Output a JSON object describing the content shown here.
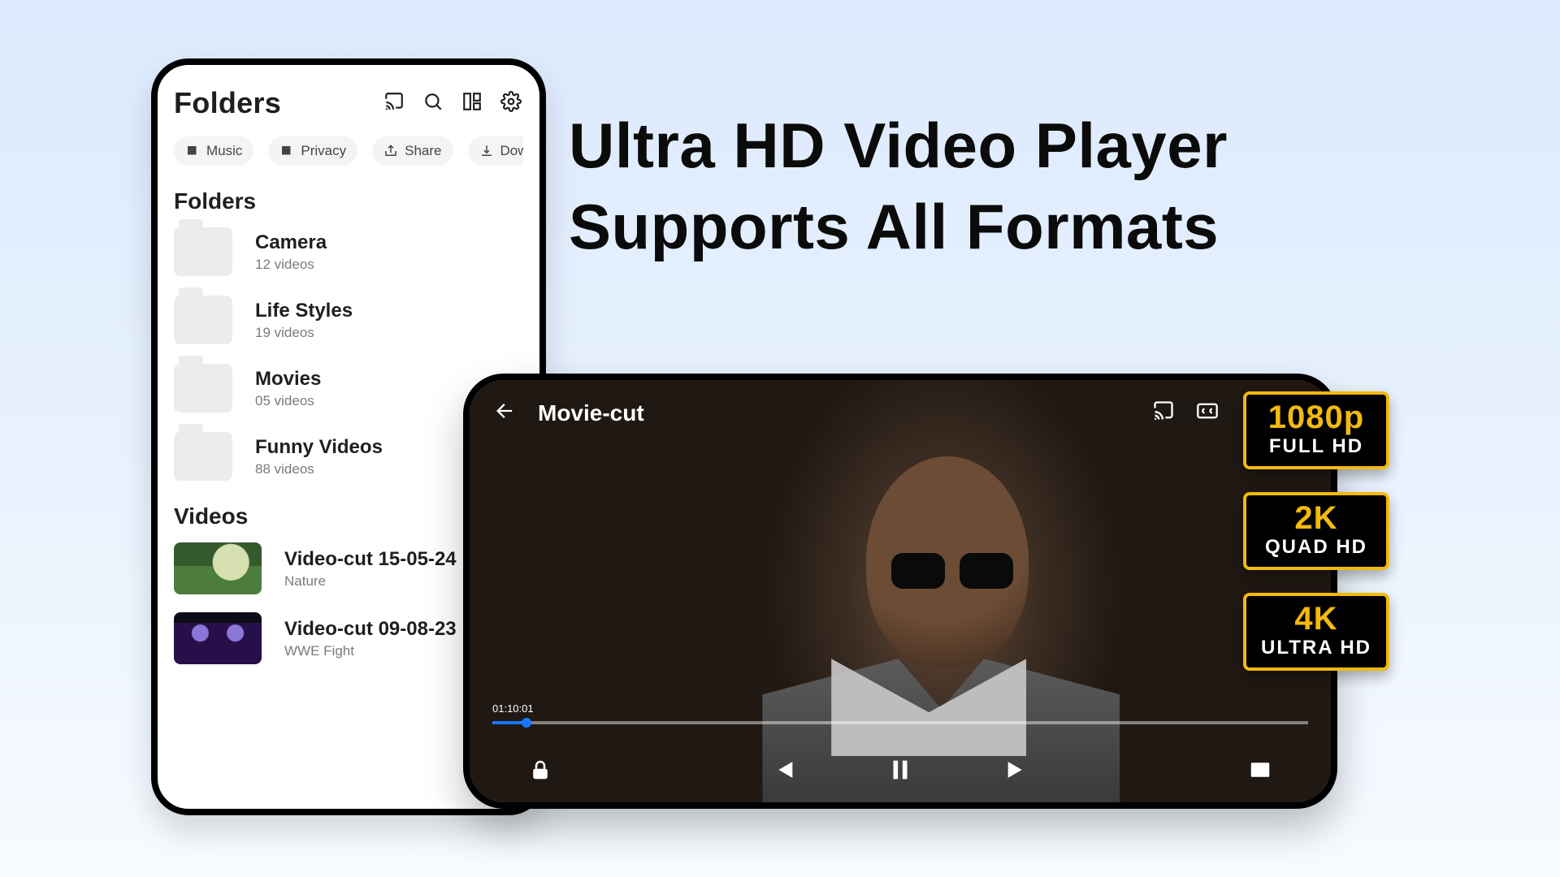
{
  "headline": {
    "line1": "Ultra HD Video Player",
    "line2": "Supports All Formats"
  },
  "phone": {
    "title": "Folders",
    "tabs": [
      {
        "label": "Music"
      },
      {
        "label": "Privacy"
      },
      {
        "label": "Share"
      },
      {
        "label": "Downloader"
      }
    ],
    "folders_section": "Folders",
    "folders": [
      {
        "name": "Camera",
        "sub": "12 videos"
      },
      {
        "name": "Life Styles",
        "sub": "19 videos"
      },
      {
        "name": "Movies",
        "sub": "05 videos"
      },
      {
        "name": "Funny Videos",
        "sub": "88 videos"
      }
    ],
    "videos_section": "Videos",
    "videos": [
      {
        "name": "Video-cut 15-05-24",
        "sub": "Nature",
        "thumb": "nature"
      },
      {
        "name": "Video-cut 09-08-23",
        "sub": "WWE Fight",
        "thumb": "wwe"
      }
    ]
  },
  "player": {
    "title": "Movie-cut",
    "time": "01:10:01"
  },
  "badges": [
    {
      "top": "1080p",
      "bottom": "FULL HD"
    },
    {
      "top": "2K",
      "bottom": "QUAD HD"
    },
    {
      "top": "4K",
      "bottom": "ULTRA HD"
    }
  ]
}
